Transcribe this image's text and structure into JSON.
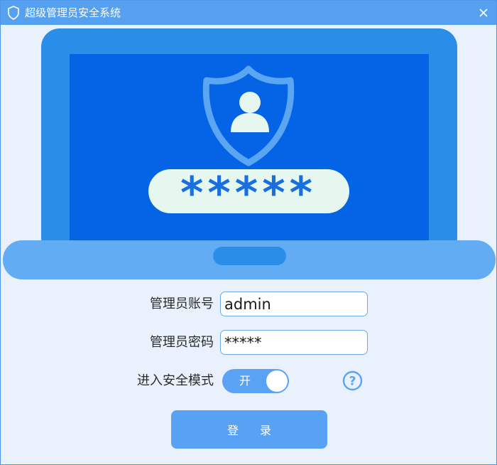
{
  "window": {
    "title": "超级管理员安全系统",
    "title_icon": "shield-icon",
    "close_icon": "close-icon"
  },
  "hero": {
    "illustration": "laptop-login-illustration",
    "password_mask": "*****",
    "colors": {
      "laptop_frame": "#2a8de8",
      "screen": "#0563e6",
      "base": "#62acf3",
      "shield": "#5aa6f2",
      "user": "#e6f7ef"
    }
  },
  "form": {
    "account_label": "管理员账号",
    "account_value": "admin",
    "password_label": "管理员密码",
    "password_value": "*****",
    "safe_mode_label": "进入安全模式",
    "safe_mode_state": "开",
    "help_icon": "question-circle-icon"
  },
  "login_button_label": "登录",
  "colors": {
    "accent": "#56a0f0",
    "button": "#57a2f4",
    "background": "#e9f2fc"
  }
}
